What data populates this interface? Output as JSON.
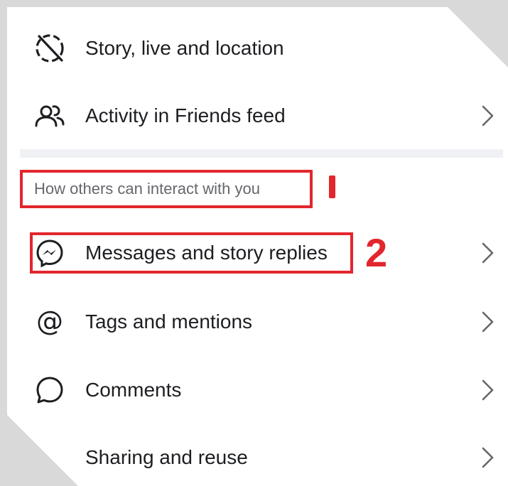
{
  "menu": {
    "items_top": [
      {
        "label": "Story, live and location",
        "icon": "story-location-off-icon"
      },
      {
        "label": "Activity in Friends feed",
        "icon": "friends-icon"
      }
    ],
    "section_title": "How others can interact with you",
    "items_section": [
      {
        "label": "Messages and story replies",
        "icon": "messenger-icon"
      },
      {
        "label": "Tags and mentions",
        "icon": "at-icon"
      },
      {
        "label": "Comments",
        "icon": "comment-bubble-icon"
      },
      {
        "label": "Sharing and reuse",
        "icon": "share-icon"
      }
    ]
  },
  "annotations": {
    "step1": "1",
    "step2": "2",
    "highlight_color": "#e2262d"
  },
  "colors": {
    "text": "#1c1e21",
    "secondary_text": "#65676b",
    "divider": "#eff1f4"
  }
}
